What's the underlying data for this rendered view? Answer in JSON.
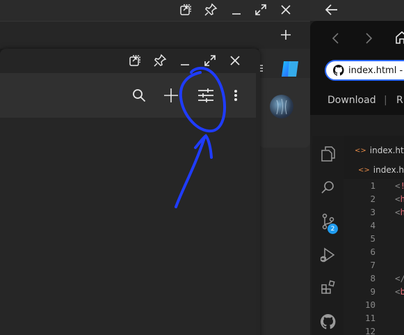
{
  "right_window": {
    "tab_title": "index.html -",
    "download_label": "Download",
    "separator": "|",
    "next_label_partial": "R",
    "breadcrumb_1": "index.htm",
    "breadcrumb_2": "index.ht",
    "scm_badge": "2"
  },
  "editor": {
    "line_numbers": [
      "1",
      "2",
      "3",
      "4",
      "5",
      "6",
      "7",
      "8",
      "9",
      "10",
      "11",
      "12"
    ],
    "code_lines": [
      {
        "lt": "<",
        "tag": "!"
      },
      {
        "lt": "<",
        "tag": "h"
      },
      {
        "lt": "<",
        "tag": "h"
      },
      {
        "lt": "",
        "tag": ""
      },
      {
        "lt": "",
        "tag": ""
      },
      {
        "lt": "",
        "tag": ""
      },
      {
        "lt": "",
        "tag": ""
      },
      {
        "lt": "</",
        "tag": ""
      },
      {
        "lt": "<",
        "tag": "b"
      },
      {
        "lt": "",
        "tag": ""
      },
      {
        "lt": "",
        "tag": ""
      },
      {
        "lt": "",
        "tag": ""
      }
    ]
  },
  "colors": {
    "annotation_blue": "#1f3cff",
    "accent_blue": "#2d6bff",
    "badge_blue": "#1f9cf0"
  },
  "icons": {
    "window_controls": [
      "snap-icon",
      "pin-icon",
      "minimize-icon",
      "expand-icon",
      "close-icon"
    ],
    "toolbar": [
      "search-icon",
      "plus-icon",
      "sliders-icon",
      "more-vertical-icon"
    ],
    "activity_bar": [
      "explorer-icon",
      "search-icon",
      "source-control-icon",
      "run-debug-icon",
      "extensions-icon",
      "github-icon"
    ]
  }
}
